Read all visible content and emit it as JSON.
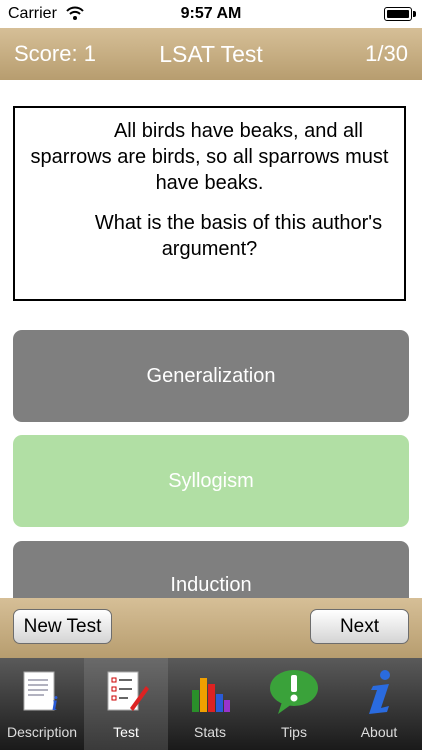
{
  "status": {
    "carrier": "Carrier",
    "time": "9:57 AM"
  },
  "header": {
    "score": "Score: 1",
    "title": "LSAT Test",
    "progress": "1/30"
  },
  "question": {
    "text1": "All birds have beaks, and all sparrows are birds, so all sparrows must have beaks.",
    "text2": "What is the basis of this author's argument?"
  },
  "answers": [
    {
      "label": "Generalization",
      "color": "#7f7f7f"
    },
    {
      "label": "Syllogism",
      "color": "#b1dfa4"
    },
    {
      "label": "Induction",
      "color": "#7f7f7f"
    }
  ],
  "footer": {
    "new_test": "New Test",
    "next": "Next"
  },
  "tabs": [
    {
      "label": "Description",
      "icon": "document-info-icon"
    },
    {
      "label": "Test",
      "icon": "checklist-icon"
    },
    {
      "label": "Stats",
      "icon": "bar-chart-icon"
    },
    {
      "label": "Tips",
      "icon": "speech-bubble-icon"
    },
    {
      "label": "About",
      "icon": "info-icon"
    }
  ],
  "active_tab": "Test",
  "colors": {
    "header": "#c9b083",
    "correct": "#b1dfa4",
    "answer": "#7f7f7f"
  }
}
